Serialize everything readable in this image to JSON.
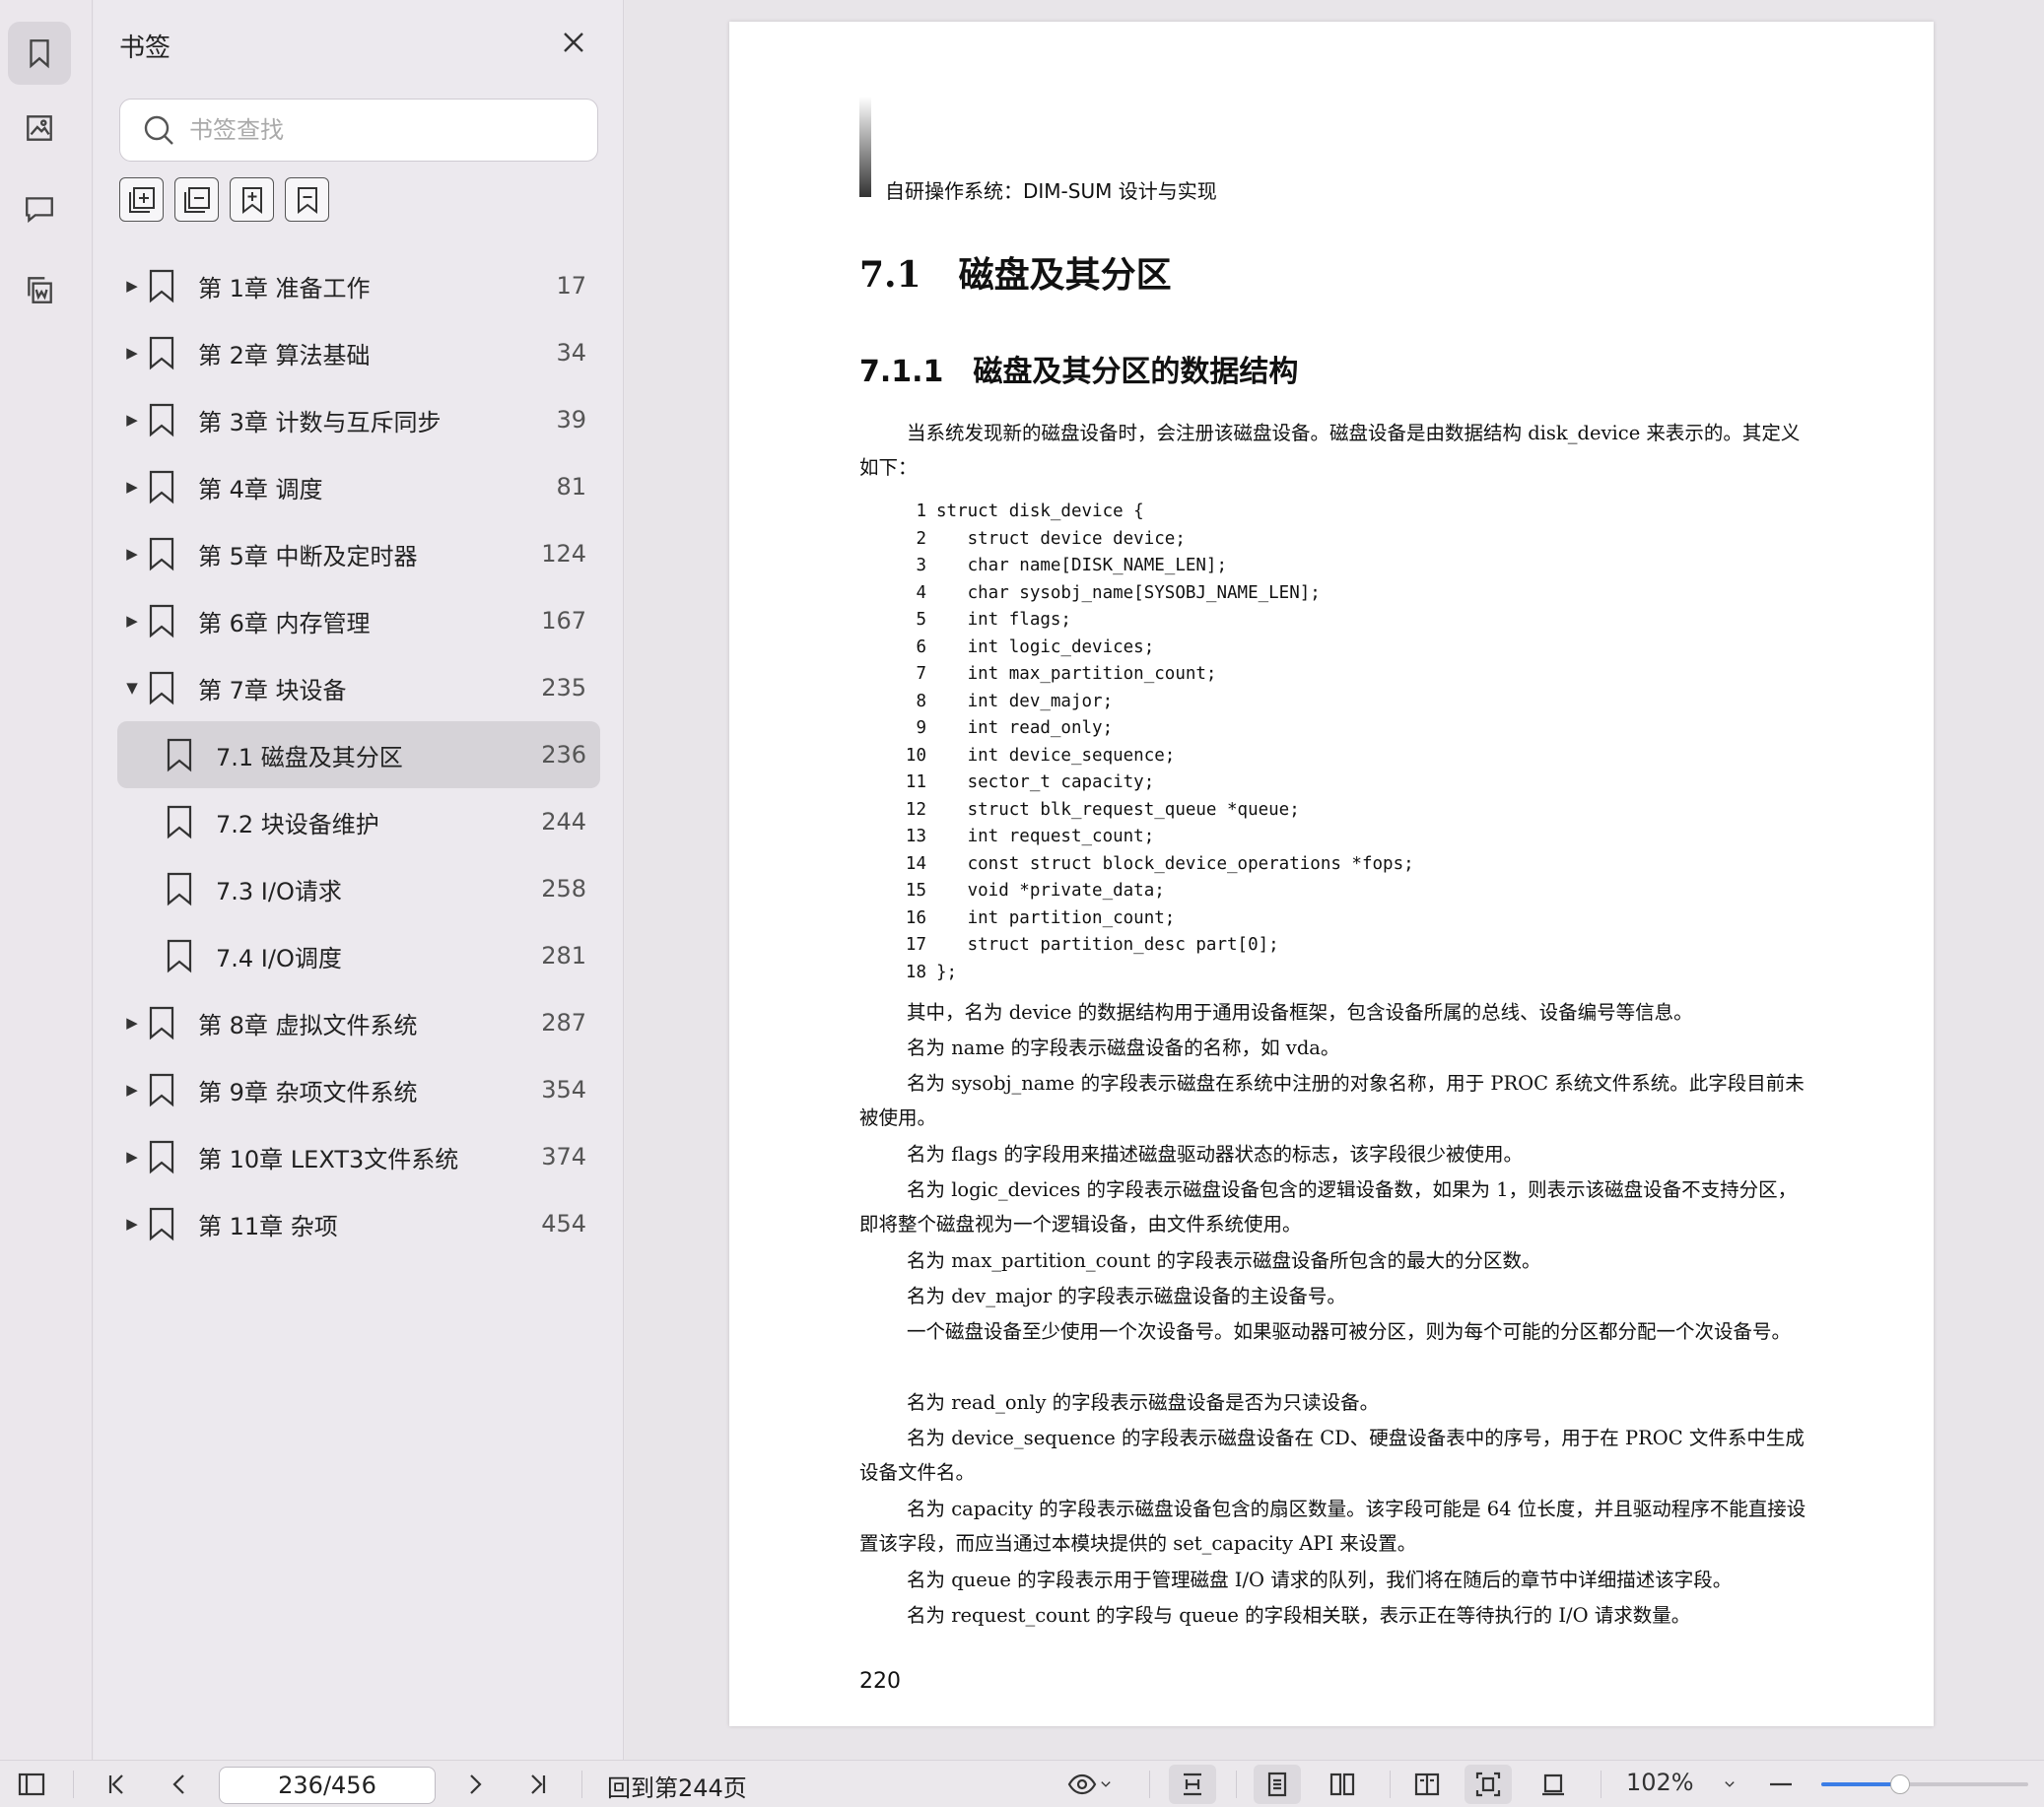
{
  "panel": {
    "title": "书签",
    "search_placeholder": "书签查找"
  },
  "bookmarks": [
    {
      "label": "第 1章 准备工作",
      "page": "17",
      "expanded": false,
      "level": 0
    },
    {
      "label": "第 2章 算法基础",
      "page": "34",
      "expanded": false,
      "level": 0
    },
    {
      "label": "第 3章 计数与互斥同步",
      "page": "39",
      "expanded": false,
      "level": 0
    },
    {
      "label": "第 4章 调度",
      "page": "81",
      "expanded": false,
      "level": 0
    },
    {
      "label": "第 5章 中断及定时器",
      "page": "124",
      "expanded": false,
      "level": 0
    },
    {
      "label": "第 6章 内存管理",
      "page": "167",
      "expanded": false,
      "level": 0
    },
    {
      "label": "第 7章 块设备",
      "page": "235",
      "expanded": true,
      "level": 0
    },
    {
      "label": "7.1 磁盘及其分区",
      "page": "236",
      "level": 1,
      "selected": true
    },
    {
      "label": "7.2 块设备维护",
      "page": "244",
      "level": 1
    },
    {
      "label": "7.3 I/O请求",
      "page": "258",
      "level": 1
    },
    {
      "label": "7.4 I/O调度",
      "page": "281",
      "level": 1
    },
    {
      "label": "第 8章 虚拟文件系统",
      "page": "287",
      "expanded": false,
      "level": 0
    },
    {
      "label": "第 9章 杂项文件系统",
      "page": "354",
      "expanded": false,
      "level": 0
    },
    {
      "label": "第 10章 LEXT3文件系统",
      "page": "374",
      "expanded": false,
      "level": 0
    },
    {
      "label": "第 11章 杂项",
      "page": "454",
      "expanded": false,
      "level": 0
    }
  ],
  "document": {
    "running_header": "自研操作系统：DIM-SUM 设计与实现",
    "section_number": "7.1",
    "section_title": "磁盘及其分区",
    "subsection_number": "7.1.1",
    "subsection_title": "磁盘及其分区的数据结构",
    "intro": "当系统发现新的磁盘设备时，会注册该磁盘设备。磁盘设备是由数据结构 disk_device 来表示的。其定义如下：",
    "code": [
      {
        "n": "1",
        "t": "struct disk_device {"
      },
      {
        "n": "2",
        "t": "   struct device device;"
      },
      {
        "n": "3",
        "t": "   char name[DISK_NAME_LEN];"
      },
      {
        "n": "4",
        "t": "   char sysobj_name[SYSOBJ_NAME_LEN];"
      },
      {
        "n": "5",
        "t": "   int flags;"
      },
      {
        "n": "6",
        "t": "   int logic_devices;"
      },
      {
        "n": "7",
        "t": "   int max_partition_count;"
      },
      {
        "n": "8",
        "t": "   int dev_major;"
      },
      {
        "n": "9",
        "t": "   int read_only;"
      },
      {
        "n": "10",
        "t": "   int device_sequence;"
      },
      {
        "n": "11",
        "t": "   sector_t capacity;"
      },
      {
        "n": "12",
        "t": "   struct blk_request_queue *queue;"
      },
      {
        "n": "13",
        "t": "   int request_count;"
      },
      {
        "n": "14",
        "t": "   const struct block_device_operations *fops;"
      },
      {
        "n": "15",
        "t": "   void *private_data;"
      },
      {
        "n": "16",
        "t": "   int partition_count;"
      },
      {
        "n": "17",
        "t": "   struct partition_desc part[0];"
      },
      {
        "n": "18",
        "t": "};"
      }
    ],
    "paragraphs": [
      "其中，名为 device 的数据结构用于通用设备框架，包含设备所属的总线、设备编号等信息。",
      "名为 name 的字段表示磁盘设备的名称，如 vda。",
      "名为 sysobj_name 的字段表示磁盘在系统中注册的对象名称，用于 PROC 系统文件系统。此字段目前未被使用。",
      "名为 flags 的字段用来描述磁盘驱动器状态的标志，该字段很少被使用。",
      "名为 logic_devices 的字段表示磁盘设备包含的逻辑设备数，如果为 1，则表示该磁盘设备不支持分区，即将整个磁盘视为一个逻辑设备，由文件系统使用。",
      "名为 max_partition_count 的字段表示磁盘设备所包含的最大的分区数。",
      "名为 dev_major 的字段表示磁盘设备的主设备号。",
      "一个磁盘设备至少使用一个次设备号。如果驱动器可被分区，则为每个可能的分区都分配一个次设备号。",
      "名为 read_only 的字段表示磁盘设备是否为只读设备。",
      "名为 device_sequence 的字段表示磁盘设备在 CD、硬盘设备表中的序号，用于在 PROC 文件系中生成设备文件名。",
      "名为 capacity 的字段表示磁盘设备包含的扇区数量。该字段可能是 64 位长度，并且驱动程序不能直接设置该字段，而应当通过本模块提供的 set_capacity API 来设置。",
      "名为 queue 的字段表示用于管理磁盘 I/O 请求的队列，我们将在随后的章节中详细描述该字段。",
      "名为 request_count 的字段与 queue 的字段相关联，表示正在等待执行的 I/O 请求数量。"
    ],
    "page_number": "220"
  },
  "toolbar": {
    "page_indicator": "236/456",
    "goto_label": "回到第244页",
    "zoom": "102%",
    "zoom_slider_fraction": 0.38
  }
}
